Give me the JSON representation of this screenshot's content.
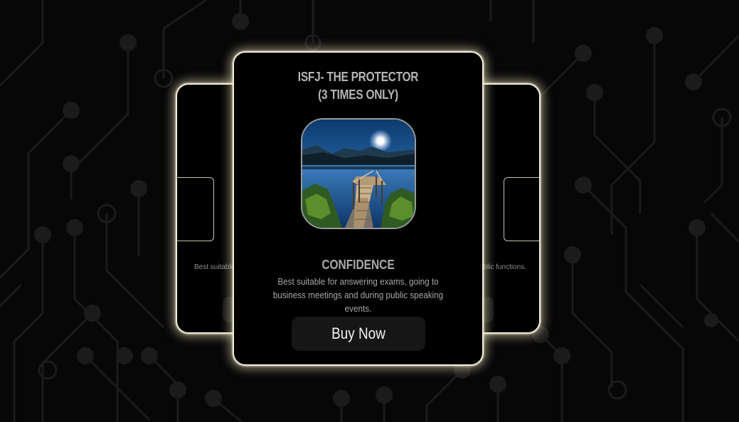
{
  "cards": {
    "left": {
      "description_fragment": "Best suitable"
    },
    "right": {
      "description_fragment": "blic functions."
    },
    "main": {
      "title_line1": "ISFJ- THE PROTECTOR",
      "title_line2": "(3 TIMES ONLY)",
      "image_icon": "moonlit-lake-pier-image",
      "heading": "CONFIDENCE",
      "description": "Best suitable for answering exams, going to business meetings and during public speaking events.",
      "button_label": "Buy Now"
    }
  },
  "colors": {
    "background": "#070707",
    "card_border_glow": "#f3eed8",
    "button_background": "#161616",
    "circuit_lines": "#1c1c1c"
  }
}
